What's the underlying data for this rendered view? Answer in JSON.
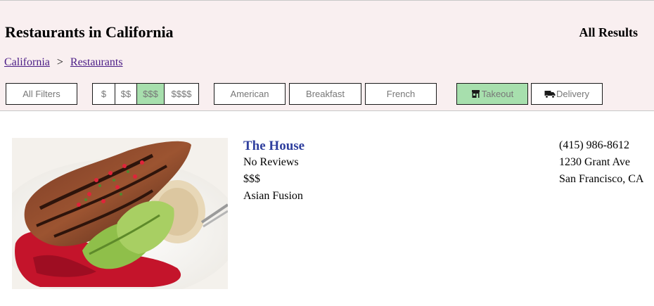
{
  "header": {
    "title": "Restaurants in California",
    "results_label": "All Results"
  },
  "breadcrumb": {
    "items": [
      "California",
      "Restaurants"
    ],
    "separator": ">"
  },
  "filters": {
    "all_filters": "All Filters",
    "price_options": [
      "$",
      "$$",
      "$$$",
      "$$$$"
    ],
    "selected_price": "$$$",
    "cuisines": [
      "American",
      "Breakfast",
      "French"
    ],
    "takeout": "Takeout",
    "delivery": "Delivery",
    "takeout_active": true,
    "active_color": "#a7dfad"
  },
  "results": [
    {
      "name": "The House",
      "reviews": "No Reviews",
      "price": "$$$",
      "category": "Asian Fusion",
      "phone": "(415) 986-8612",
      "address_line1": "1230 Grant Ave",
      "address_line2": "San Francisco, CA"
    }
  ],
  "icons": {
    "takeout": "store-icon",
    "delivery": "truck-icon"
  }
}
